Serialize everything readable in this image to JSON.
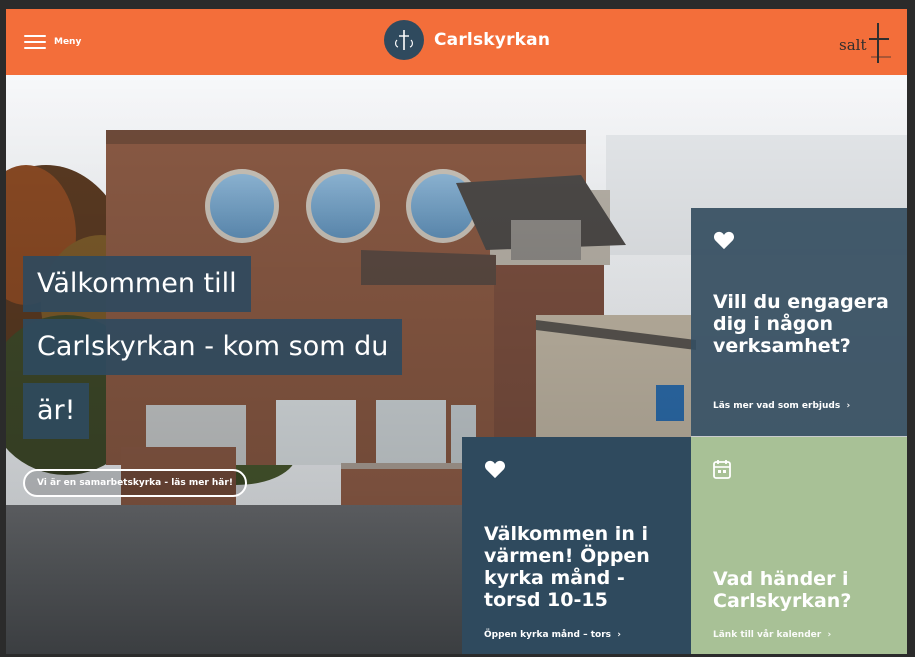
{
  "header": {
    "menu_label": "Meny",
    "site_name": "Carlskyrkan",
    "partner_logo_text": "salt",
    "colors": {
      "header_bg": "#f36e3a",
      "brand_navy": "#2f4a5e"
    },
    "icons": [
      "hamburger-menu-icon",
      "carlskyrkan-logo",
      "salt-logo"
    ]
  },
  "hero": {
    "title_lines": [
      "Välkommen till",
      "Carlskyrkan - kom som du",
      "är!"
    ],
    "cta_label": "Vi är en samarbetskyrka - läs mer här!"
  },
  "tiles": [
    {
      "icon": "heart-icon",
      "title": "Vill du engagera dig i någon verksamhet?",
      "link_label": "Läs mer vad som erbjuds",
      "color": "#364f61"
    },
    {
      "icon": "heart-icon",
      "title": "Välkommen in i värmen! Öppen kyrka månd - torsd 10-15",
      "link_label": "Öppen kyrka månd – tors",
      "color": "#2f4a5e"
    },
    {
      "icon": "calendar-icon",
      "title": "Vad händer i Carlskyrkan?",
      "link_label": "Länk till vår kalender",
      "color": "#a8c196"
    }
  ]
}
